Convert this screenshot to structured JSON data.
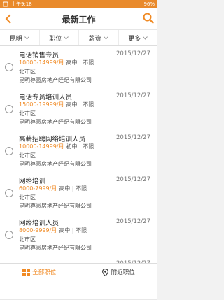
{
  "status_bar": {
    "time": "上午9:18",
    "battery": "96%"
  },
  "header": {
    "title": "最新工作"
  },
  "filters": [
    {
      "label": "昆明"
    },
    {
      "label": "职位"
    },
    {
      "label": "薪资"
    },
    {
      "label": "更多"
    }
  ],
  "jobs": [
    {
      "title": "电话销售专员",
      "date": "2015/12/27",
      "salary": "10000-14999/月",
      "requirements": "高中 | 不限",
      "area": "北市区",
      "company": "昆明尊园房地产经纪有限公司"
    },
    {
      "title": "电话专员培训人员",
      "date": "2015/12/27",
      "salary": "15000-19999/月",
      "requirements": "高中 | 不限",
      "area": "北市区",
      "company": "昆明尊园房地产经纪有限公司"
    },
    {
      "title": "高薪招聘网络培训人员",
      "date": "2015/12/27",
      "salary": "10000-14999/月",
      "requirements": "初中 | 不限",
      "area": "北市区",
      "company": "昆明尊园房地产经纪有限公司"
    },
    {
      "title": "网络培训",
      "date": "2015/12/27",
      "salary": "6000-7999/月",
      "requirements": "高中 | 不限",
      "area": "北市区",
      "company": "昆明尊园房地产经纪有限公司"
    },
    {
      "title": "网络培训人员",
      "date": "2015/12/27",
      "salary": "8000-9999/月",
      "requirements": "高中 | 不限",
      "area": "北市区",
      "company": "昆明尊园房地产经纪有限公司"
    },
    {
      "title": "",
      "date": "2015/12/27",
      "salary": "",
      "requirements": "",
      "area": "",
      "company": ""
    }
  ],
  "tabbar": {
    "all_jobs": "全部职位",
    "nearby_jobs": "附近职位"
  },
  "colors": {
    "accent": "#f08a24",
    "status_bar": "#e98a2b"
  },
  "icons": {
    "back": "chevron-left-icon",
    "search": "search-icon",
    "filter": "chevron-down-icon",
    "all_jobs": "grid-icon",
    "nearby": "location-pin-icon"
  }
}
